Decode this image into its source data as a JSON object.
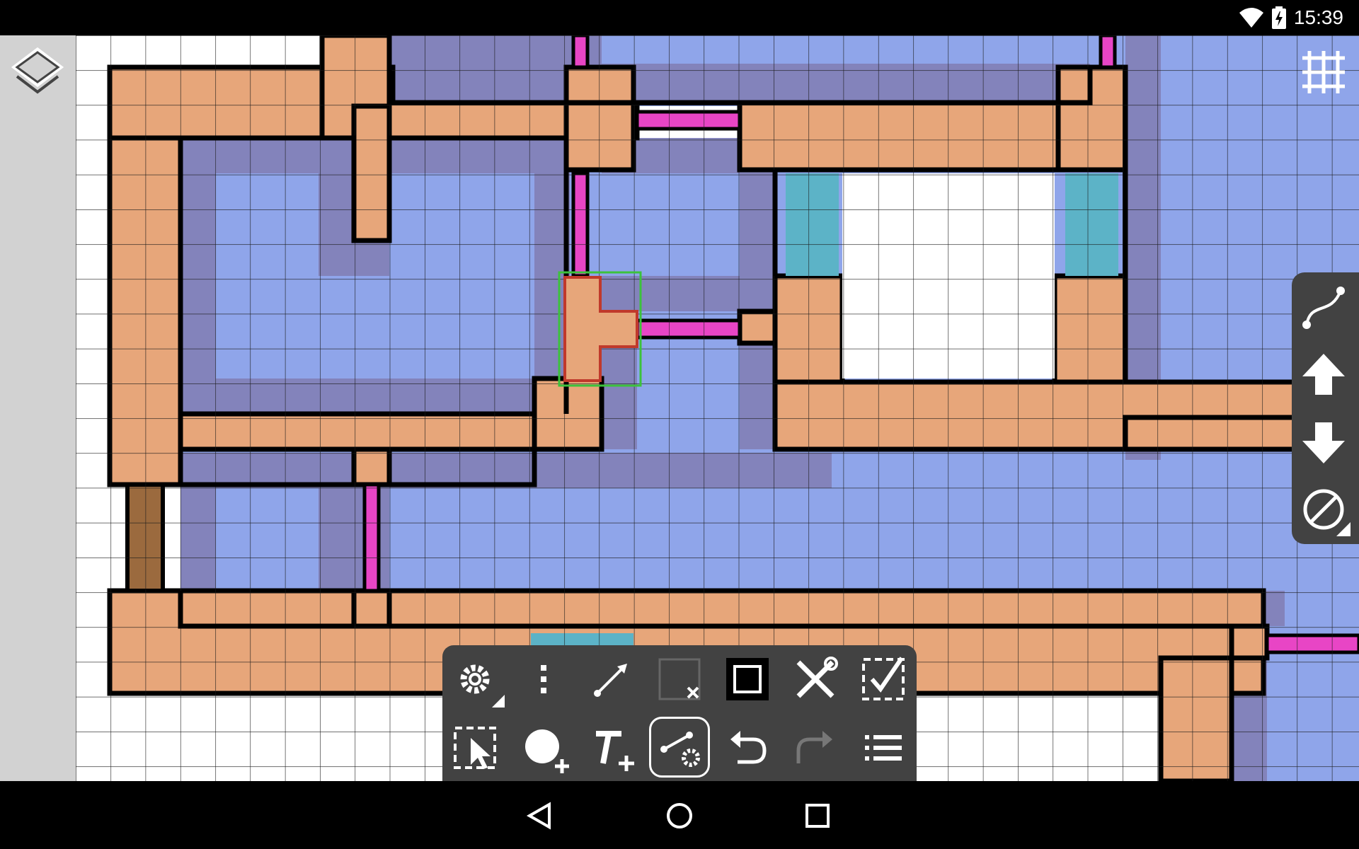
{
  "status_bar": {
    "time": "15:39",
    "icons": [
      "wifi-icon",
      "battery-charging-icon"
    ]
  },
  "map": {
    "colors": {
      "background_white": "#ffffff",
      "grid_line": "#1a1a1a",
      "floor_blue": "#8fa5ea",
      "wall_purple": "#8383bb",
      "room_orange": "#e7a67a",
      "door_magenta": "#e845c5",
      "window_teal": "#5cb3c7",
      "stairs_brown": "#9b6a3e",
      "wall_outline": "#000000",
      "selection_red": "#c0392b",
      "selection_green": "#3cc23c"
    }
  },
  "top_left": {
    "icon": "layers-icon"
  },
  "top_right": {
    "icon": "grid-icon"
  },
  "side_panel": {
    "items": [
      {
        "icon": "curve-path-icon"
      },
      {
        "icon": "arrow-up-icon"
      },
      {
        "icon": "arrow-down-icon"
      },
      {
        "icon": "no-fill-icon"
      }
    ]
  },
  "toolbar": {
    "row1": [
      {
        "icon": "settings-icon"
      },
      {
        "icon": "more-vert-icon"
      },
      {
        "icon": "line-arrow-icon"
      },
      {
        "icon": "no-border-icon"
      },
      {
        "icon": "border-icon"
      },
      {
        "icon": "tools-icon"
      },
      {
        "icon": "confirm-selection-icon"
      }
    ],
    "row2": [
      {
        "icon": "select-icon"
      },
      {
        "icon": "add-shape-icon"
      },
      {
        "icon": "add-text-icon"
      },
      {
        "icon": "edit-path-icon",
        "active": true
      },
      {
        "icon": "undo-icon"
      },
      {
        "icon": "redo-icon",
        "disabled": true
      },
      {
        "icon": "list-icon"
      }
    ]
  },
  "nav_bar": {
    "icons": [
      "back-icon",
      "home-icon",
      "recents-icon"
    ]
  }
}
